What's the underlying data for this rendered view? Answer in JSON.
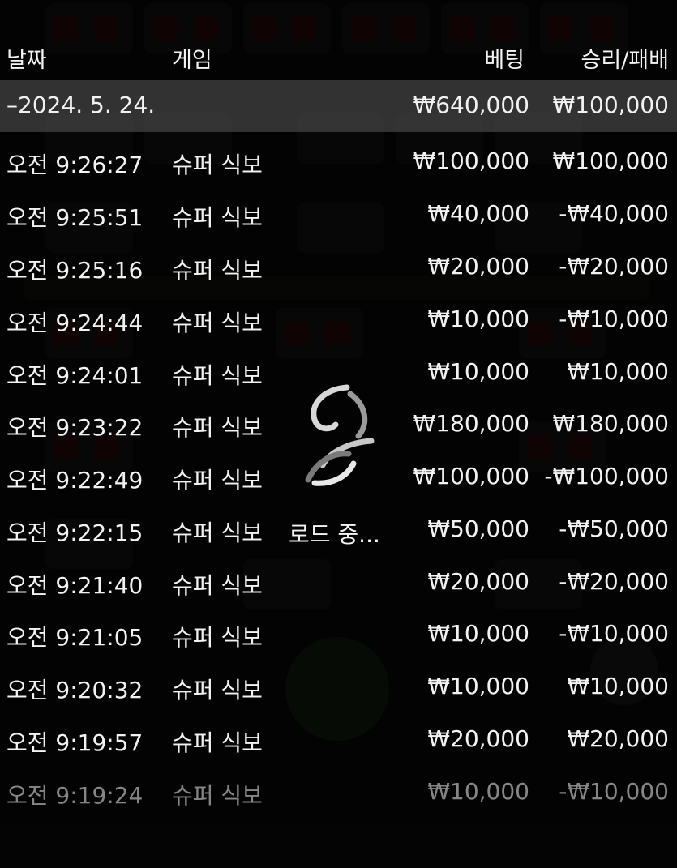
{
  "table": {
    "columns": {
      "date": "날짜",
      "game": "게임",
      "bet": "베팅",
      "winloss": "승리/패배"
    },
    "date_group": {
      "label": "–2024. 5. 24.",
      "bet": "₩640,000",
      "winloss": "₩100,000"
    },
    "rows": [
      {
        "time": "오전 9:26:27",
        "game": "슈퍼 식보",
        "bet": "₩100,000",
        "winloss": "₩100,000"
      },
      {
        "time": "오전 9:25:51",
        "game": "슈퍼 식보",
        "bet": "₩40,000",
        "winloss": "-₩40,000"
      },
      {
        "time": "오전 9:25:16",
        "game": "슈퍼 식보",
        "bet": "₩20,000",
        "winloss": "-₩20,000"
      },
      {
        "time": "오전 9:24:44",
        "game": "슈퍼 식보",
        "bet": "₩10,000",
        "winloss": "-₩10,000"
      },
      {
        "time": "오전 9:24:01",
        "game": "슈퍼 식보",
        "bet": "₩10,000",
        "winloss": "₩10,000"
      },
      {
        "time": "오전 9:23:22",
        "game": "슈퍼 식보",
        "bet": "₩180,000",
        "winloss": "₩180,000"
      },
      {
        "time": "오전 9:22:49",
        "game": "슈퍼 식보",
        "bet": "₩100,000",
        "winloss": "-₩100,000"
      },
      {
        "time": "오전 9:22:15",
        "game": "슈퍼 식보",
        "bet": "₩50,000",
        "winloss": "-₩50,000"
      },
      {
        "time": "오전 9:21:40",
        "game": "슈퍼 식보",
        "bet": "₩20,000",
        "winloss": "-₩20,000"
      },
      {
        "time": "오전 9:21:05",
        "game": "슈퍼 식보",
        "bet": "₩10,000",
        "winloss": "-₩10,000"
      },
      {
        "time": "오전 9:20:32",
        "game": "슈퍼 식보",
        "bet": "₩10,000",
        "winloss": "₩10,000"
      },
      {
        "time": "오전 9:19:57",
        "game": "슈퍼 식보",
        "bet": "₩20,000",
        "winloss": "₩20,000"
      },
      {
        "time": "오전 9:19:24",
        "game": "슈퍼 식보",
        "bet": "₩10,000",
        "winloss": "-₩10,000"
      }
    ]
  },
  "loading": {
    "text": "로드 중...",
    "icon": "spinner-icon"
  },
  "colors": {
    "background": "#0d0d0d",
    "text": "#f2f2f2",
    "date_row": "#4a4a4a"
  }
}
